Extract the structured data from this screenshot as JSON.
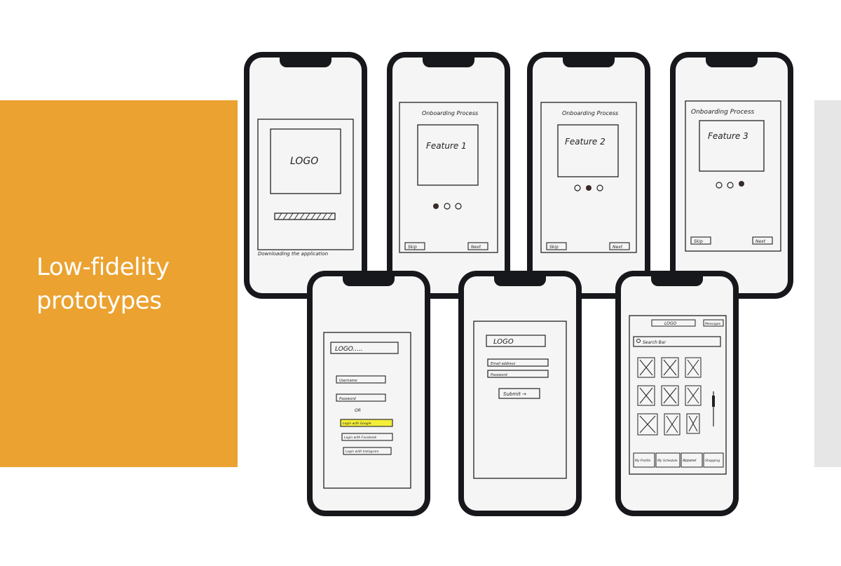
{
  "slide": {
    "title_line1": "Low-fidelity",
    "title_line2": "prototypes",
    "accent_color": "#eba230",
    "side_panel_color": "#e6e6e6"
  },
  "prototypes": [
    {
      "screen": "splash",
      "logo": "LOGO",
      "caption": "Downloading the application"
    },
    {
      "screen": "onboarding-1",
      "header": "Onboarding Process",
      "feature": "Feature 1",
      "active_dot": 1,
      "skip": "Skip",
      "next": "Next"
    },
    {
      "screen": "onboarding-2",
      "header": "Onboarding Process",
      "feature": "Feature 2",
      "active_dot": 2,
      "skip": "Skip",
      "next": "Next"
    },
    {
      "screen": "onboarding-3",
      "header": "Onboarding Process",
      "feature": "Feature 3",
      "active_dot": 3,
      "skip": "Skip",
      "next": "Next"
    },
    {
      "screen": "signup",
      "logo": "LOGO.....",
      "username": "Username",
      "password": "Password",
      "or": "OR",
      "google": "Login with Google",
      "facebook": "Login with Facebook",
      "instagram": "Login with Instagram"
    },
    {
      "screen": "login",
      "logo": "LOGO",
      "email": "Email address",
      "password": "Password",
      "submit": "Submit →"
    },
    {
      "screen": "home",
      "logo": "LOGO",
      "messages": "Messages",
      "search": "Search Bar",
      "tabs": [
        "My Profile",
        "My Schedule",
        "Apparel",
        "Shopping"
      ]
    }
  ]
}
